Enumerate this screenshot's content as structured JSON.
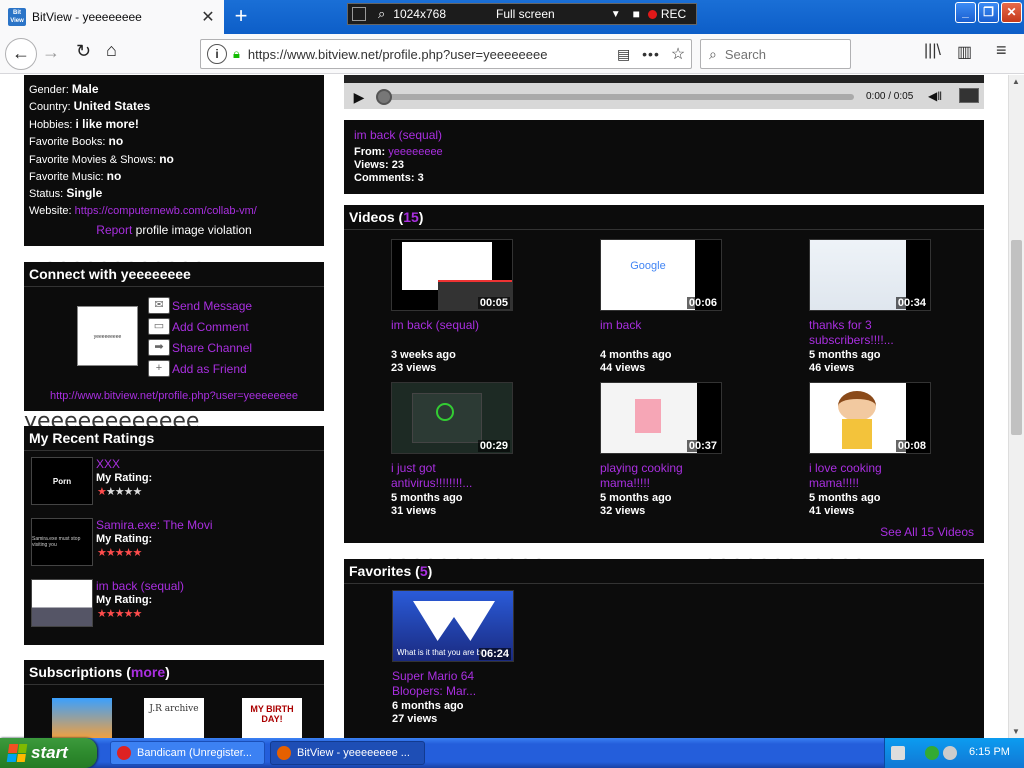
{
  "browser": {
    "tab_title": "BitView - yeeeeeeee",
    "favicon_text": "Bit View",
    "url": "https://www.bitview.net/profile.php?user=yeeeeeeee",
    "search_placeholder": "Search"
  },
  "bandicam": {
    "resolution": "1024x768",
    "mode": "Full screen",
    "rec_label": "REC"
  },
  "watermark": "yeeeeeeeeeeee",
  "profile": {
    "gender_label": "Gender:",
    "gender": "Male",
    "country_label": "Country:",
    "country": "United States",
    "hobbies_label": "Hobbies:",
    "hobbies": "i like more!",
    "books_label": "Favorite Books:",
    "books": "no",
    "movies_label": "Favorite Movies & Shows:",
    "movies": "no",
    "music_label": "Favorite Music:",
    "music": "no",
    "status_label": "Status:",
    "status": "Single",
    "website_label": "Website:",
    "website": "https://computernewb.com/collab-vm/",
    "report_link": "Report",
    "report_text": "profile image violation"
  },
  "connect": {
    "title": "Connect with yeeeeeeee",
    "avatar_text": "yeeeeeeeee",
    "actions": [
      "Send Message",
      "Add Comment",
      "Share Channel",
      "Add as Friend"
    ],
    "channel_url": "http://www.bitview.net/profile.php?user=yeeeeeeee"
  },
  "ratings": {
    "title": "My Recent Ratings",
    "label": "My Rating:",
    "items": [
      {
        "title": "XXX",
        "stars": 1,
        "thumb_text": "Porn"
      },
      {
        "title": "Samira.exe: The Movi",
        "stars": 5,
        "thumb_text": "Samira.exe must stop visiting you"
      },
      {
        "title": "im back (sequal)",
        "stars": 5,
        "thumb_text": ""
      }
    ]
  },
  "subscriptions": {
    "title": "Subscriptions",
    "more": "more",
    "thumb_texts": [
      "J.R archive",
      "MY BIRTH DAY!"
    ]
  },
  "player": {
    "time": "0:00 / 0:05",
    "progress": 0
  },
  "current_video": {
    "title": "im back (sequal)",
    "from_label": "From:",
    "from": "yeeeeeeee",
    "views_label": "Views:",
    "views": "23",
    "comments_label": "Comments:",
    "comments": "3"
  },
  "videos": {
    "title": "Videos",
    "count": "15",
    "see_all": "See All 15 Videos",
    "items": [
      {
        "title": "im back (sequal)",
        "ago": "3 weeks ago",
        "views": "23 views",
        "duration": "00:05"
      },
      {
        "title": "im back",
        "ago": "4 months ago",
        "views": "44 views",
        "duration": "00:06",
        "thumb_text": "Google"
      },
      {
        "title": "thanks for 3 subscribers!!!!...",
        "ago": "5 months ago",
        "views": "46 views",
        "duration": "00:34"
      },
      {
        "title": "i just got antivirus!!!!!!!!...",
        "ago": "5 months ago",
        "views": "31 views",
        "duration": "00:29"
      },
      {
        "title": "playing cooking mama!!!!!",
        "ago": "5 months ago",
        "views": "32 views",
        "duration": "00:37"
      },
      {
        "title": "i love cooking mama!!!!!",
        "ago": "5 months ago",
        "views": "41 views",
        "duration": "00:08"
      }
    ]
  },
  "favorites": {
    "title": "Favorites",
    "count": "5",
    "items": [
      {
        "title": "Super Mario 64 Bloopers: Mar...",
        "ago": "6 months ago",
        "views": "27 views",
        "duration": "06:24",
        "caption": "What is it that you are bl..."
      }
    ]
  },
  "taskbar": {
    "start": "start",
    "tasks": [
      "Bandicam (Unregister...",
      "BitView - yeeeeeeee ..."
    ],
    "clock": "6:15 PM"
  }
}
